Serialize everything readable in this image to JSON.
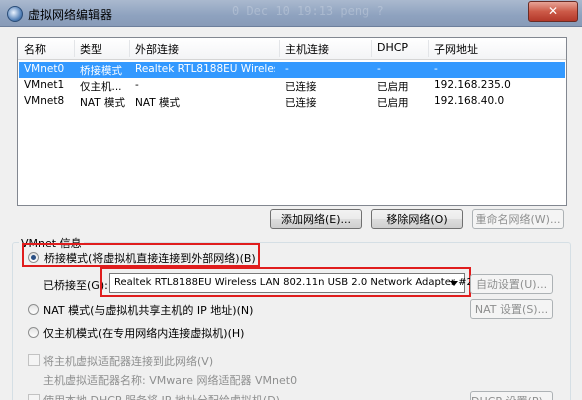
{
  "window": {
    "title": "虚拟网络编辑器",
    "close_label": "✕",
    "ghost_text": "0 Dec 10 19:13 peng ?"
  },
  "table": {
    "columns": [
      "名称",
      "类型",
      "外部连接",
      "主机连接",
      "DHCP",
      "子网地址"
    ],
    "rows": [
      {
        "name": "VMnet0",
        "type": "桥接模式",
        "external": "Realtek RTL8188EU Wireles...",
        "host": "-",
        "dhcp": "-",
        "subnet": "-",
        "selected": true
      },
      {
        "name": "VMnet1",
        "type": "仅主机...",
        "external": "-",
        "host": "已连接",
        "dhcp": "已启用",
        "subnet": "192.168.235.0",
        "selected": false
      },
      {
        "name": "VMnet8",
        "type": "NAT 模式",
        "external": "NAT 模式",
        "host": "已连接",
        "dhcp": "已启用",
        "subnet": "192.168.40.0",
        "selected": false
      }
    ]
  },
  "buttons": {
    "add_network": "添加网络(E)...",
    "remove_network": "移除网络(O)",
    "rename_network": "重命名网络(W)..."
  },
  "vmnet_info": {
    "label": "VMnet 信息",
    "bridged": {
      "label": "桥接模式(将虚拟机直接连接到外部网络)(B)",
      "checked": true
    },
    "bridged_to": {
      "label": "已桥接至(G):",
      "value": "Realtek RTL8188EU Wireless LAN 802.11n USB 2.0 Network Adapter #2",
      "auto_button": "自动设置(U)..."
    },
    "nat": {
      "label": "NAT 模式(与虚拟机共享主机的 IP 地址)(N)",
      "settings_button": "NAT 设置(S)..."
    },
    "host_only": {
      "label": "仅主机模式(在专用网络内连接虚拟机)(H)"
    },
    "connect_adapter": {
      "label": "将主机虚拟适配器连接到此网络(V)"
    },
    "adapter_name": {
      "label": "主机虚拟适配器名称: VMware 网络适配器 VMnet0"
    },
    "dhcp": {
      "label": "使用本地 DHCP 服务将 IP 地址分配给虚拟机(D)",
      "settings_button": "DHCP 设置(P)..."
    }
  },
  "colors": {
    "selection": "#3399ff",
    "highlight_box": "#e01d1d"
  }
}
